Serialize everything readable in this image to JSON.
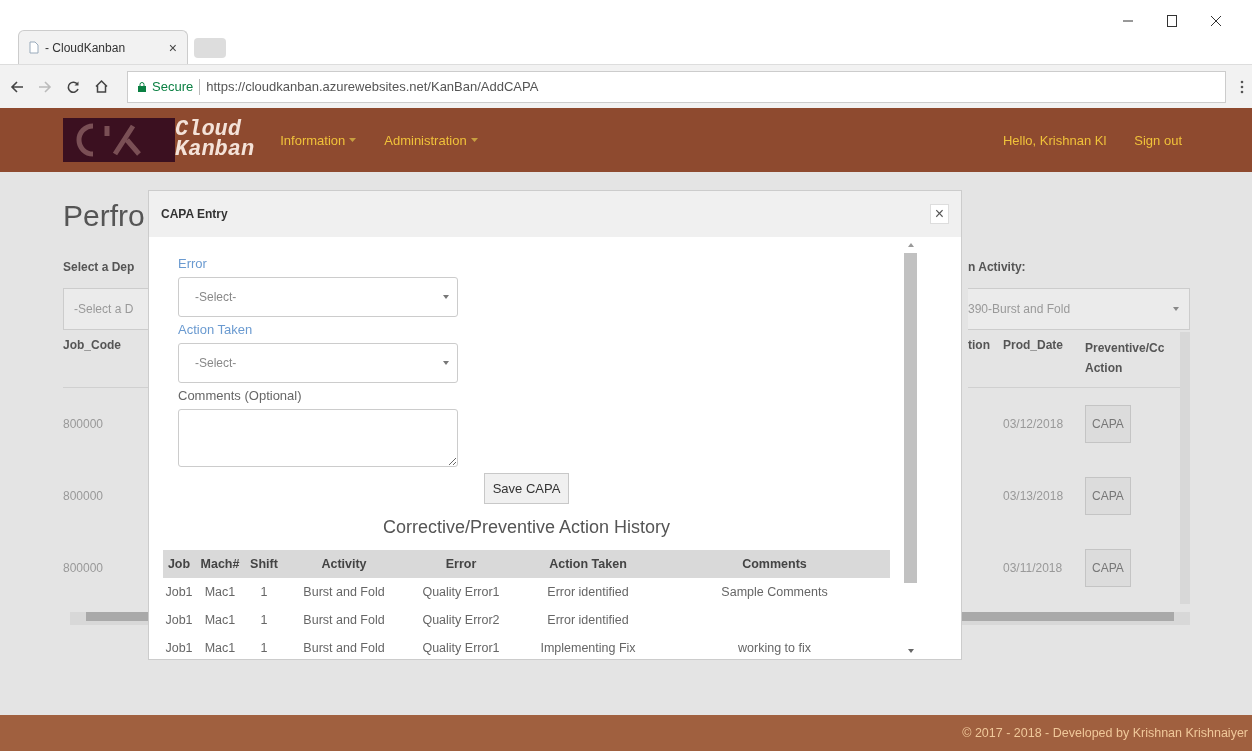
{
  "browser": {
    "tab": {
      "title": "- CloudKanban",
      "close": "×"
    },
    "address": {
      "security": "Secure",
      "url": "https://cloudkanban.azurewebsites.net/KanBan/AddCAPA"
    }
  },
  "navbar": {
    "brand": [
      "Cloud",
      "Kanban"
    ],
    "menus": [
      "Information",
      "Administration"
    ],
    "greeting": "Hello, Krishnan Kl",
    "sign_out": "Sign out"
  },
  "page": {
    "title": "Perfro",
    "department_label": "Select a Dep",
    "department_select": "-Select a D",
    "activity_label": "n Activity:",
    "activity_select": "390-Burst and Fold",
    "left_columns": [
      "Job_Code"
    ],
    "right_columns": [
      "tion",
      "Prod_Date",
      "Preventive/Cc Action"
    ],
    "rows": [
      {
        "job_code": "800000",
        "prod_date": "03/12/2018",
        "button": "CAPA"
      },
      {
        "job_code": "800000",
        "prod_date": "03/13/2018",
        "button": "CAPA"
      },
      {
        "job_code": "800000",
        "prod_date": "03/11/2018",
        "button": "CAPA"
      }
    ]
  },
  "modal": {
    "title": "CAPA Entry",
    "close": "×",
    "fields": [
      {
        "kind": "select",
        "label": "Error",
        "required": true,
        "value": "-Select-"
      },
      {
        "kind": "select",
        "label": "Action Taken",
        "required": true,
        "value": "-Select-"
      },
      {
        "kind": "textarea",
        "label": "Comments (Optional)",
        "required": false
      }
    ],
    "save_button": "Save CAPA",
    "history_title": "Corrective/Preventive Action History",
    "history_columns": [
      "Job",
      "Mach#",
      "Shift",
      "Activity",
      "Error",
      "Action Taken",
      "Comments"
    ],
    "history_rows": [
      {
        "job": "Job1",
        "machine": "Mac1",
        "shift": "1",
        "activity": "Burst and Fold",
        "error": "Quality Error1",
        "action_taken": "Error identified",
        "comments": "Sample Comments"
      },
      {
        "job": "Job1",
        "machine": "Mac1",
        "shift": "1",
        "activity": "Burst and Fold",
        "error": "Quality Error2",
        "action_taken": "Error identified"
      },
      {
        "job": "Job1",
        "machine": "Mac1",
        "shift": "1",
        "activity": "Burst and Fold",
        "error": "Quality Error1",
        "action_taken": "Implementing Fix",
        "comments": "working to fix"
      }
    ]
  },
  "footer": "© 2017 - 2018 - Developed by Krishnan Krishnaiyer"
}
